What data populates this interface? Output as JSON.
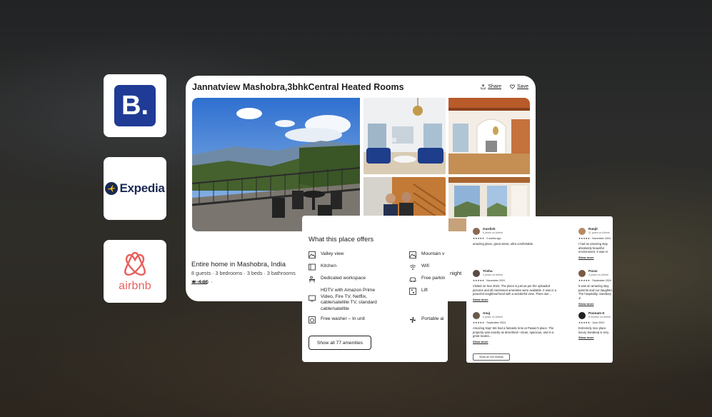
{
  "logos": {
    "booking": {
      "letter": "B.",
      "color": "#1f3b95"
    },
    "expedia": {
      "text": "Expedia",
      "color": "#1b2a52"
    },
    "airbnb": {
      "text": "airbnb",
      "color": "#e8605c"
    }
  },
  "listing": {
    "title": "Jannatview Mashobra,3bhkCentral Heated Rooms",
    "share_label": "Share",
    "save_label": "Save",
    "home_type": "Entire home in Mashobra, India",
    "details": "8 guests · 3 bedrooms · 3 beds · 3 bathrooms",
    "rating": "4.86",
    "reviews_link": "153 reviews",
    "price_suffix": "night"
  },
  "amenities": {
    "title": "What this place offers",
    "left": [
      {
        "icon": "mountain-view-icon",
        "label": "Valley view"
      },
      {
        "icon": "kitchen-icon",
        "label": "Kitchen"
      },
      {
        "icon": "workspace-icon",
        "label": "Dedicated workspace"
      },
      {
        "icon": "tv-icon",
        "label": "HDTV with Amazon Prime Video, Fire TV, Netflix, cable/satellite TV, standard cable/satellite"
      },
      {
        "icon": "washer-icon",
        "label": "Free washer – In unit"
      }
    ],
    "right": [
      {
        "icon": "mountain-icon",
        "label": "Mountain v"
      },
      {
        "icon": "wifi-icon",
        "label": "Wifi"
      },
      {
        "icon": "car-icon",
        "label": "Free parkin"
      },
      {
        "icon": "lift-icon",
        "label": "Lift"
      },
      {
        "icon": "fan-icon",
        "label": "Portable ai"
      }
    ],
    "show_all": "Show all 77 amenities"
  },
  "reviews": {
    "items": [
      {
        "name": "Gurdish",
        "sub": "6 years on Airbnb",
        "meta": "★★★★★ · 2 weeks ago",
        "text": "amazing place, great views, ultra comfortable.",
        "more": ""
      },
      {
        "name": "Trisha",
        "sub": "4 years on Airbnb",
        "meta": "★★★★★ · November 2024",
        "text": "Visited on Nov 2024. The place is just as per the uploaded pictures and all mentioned amenities were available. It was in a peaceful neighbourhood with a wonderful view. There wer...",
        "more": "Show more"
      },
      {
        "name": "Anuj",
        "sub": "6 years on Airbnb",
        "meta": "★★★★★ · September 2024",
        "text": "Amazing stay! We had a fantastic time at Pawan's place. The property was exactly as described—clean, spacious, and in a great locatio...",
        "more": "Show more"
      },
      {
        "name": "Ranjit",
        "sub": "11 years on Airbnb",
        "meta": "★★★★★ · November 2024",
        "text": "I had an amazing stay absolutely beautiful environment. It was m",
        "more": "Show more"
      },
      {
        "name": "Paras",
        "sub": "4 years on Airbnb",
        "meta": "★★★★★ · September 2024",
        "text": "It was an amazing stay parents and our daughter. The hospitality. Sandeep Ji",
        "more": "Show more"
      },
      {
        "name": "Poonam K",
        "sub": "6 months on Airbnb",
        "meta": "★★★★★ · June 2024",
        "text": "Extremely nice place luxury Sandeep is very",
        "more": "Show more"
      }
    ],
    "show_all": "Show all 153 reviews"
  }
}
